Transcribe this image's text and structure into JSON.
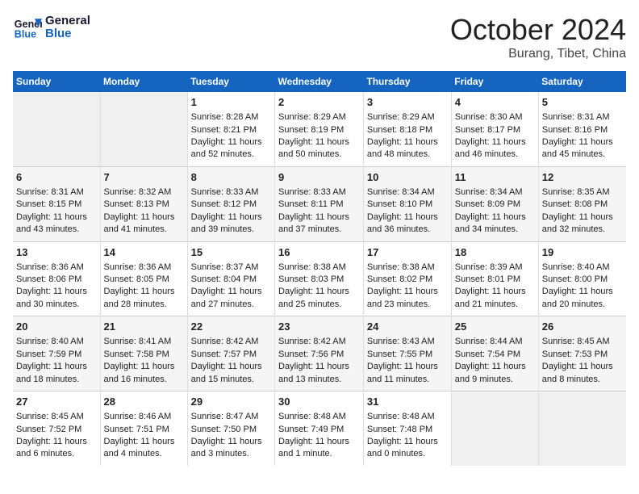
{
  "header": {
    "logo_line1": "General",
    "logo_line2": "Blue",
    "month": "October 2024",
    "location": "Burang, Tibet, China"
  },
  "weekdays": [
    "Sunday",
    "Monday",
    "Tuesday",
    "Wednesday",
    "Thursday",
    "Friday",
    "Saturday"
  ],
  "weeks": [
    [
      {
        "num": "",
        "info": "",
        "empty": true
      },
      {
        "num": "",
        "info": "",
        "empty": true
      },
      {
        "num": "1",
        "info": "Sunrise: 8:28 AM\nSunset: 8:21 PM\nDaylight: 11 hours and 52 minutes."
      },
      {
        "num": "2",
        "info": "Sunrise: 8:29 AM\nSunset: 8:19 PM\nDaylight: 11 hours and 50 minutes."
      },
      {
        "num": "3",
        "info": "Sunrise: 8:29 AM\nSunset: 8:18 PM\nDaylight: 11 hours and 48 minutes."
      },
      {
        "num": "4",
        "info": "Sunrise: 8:30 AM\nSunset: 8:17 PM\nDaylight: 11 hours and 46 minutes."
      },
      {
        "num": "5",
        "info": "Sunrise: 8:31 AM\nSunset: 8:16 PM\nDaylight: 11 hours and 45 minutes."
      }
    ],
    [
      {
        "num": "6",
        "info": "Sunrise: 8:31 AM\nSunset: 8:15 PM\nDaylight: 11 hours and 43 minutes."
      },
      {
        "num": "7",
        "info": "Sunrise: 8:32 AM\nSunset: 8:13 PM\nDaylight: 11 hours and 41 minutes."
      },
      {
        "num": "8",
        "info": "Sunrise: 8:33 AM\nSunset: 8:12 PM\nDaylight: 11 hours and 39 minutes."
      },
      {
        "num": "9",
        "info": "Sunrise: 8:33 AM\nSunset: 8:11 PM\nDaylight: 11 hours and 37 minutes."
      },
      {
        "num": "10",
        "info": "Sunrise: 8:34 AM\nSunset: 8:10 PM\nDaylight: 11 hours and 36 minutes."
      },
      {
        "num": "11",
        "info": "Sunrise: 8:34 AM\nSunset: 8:09 PM\nDaylight: 11 hours and 34 minutes."
      },
      {
        "num": "12",
        "info": "Sunrise: 8:35 AM\nSunset: 8:08 PM\nDaylight: 11 hours and 32 minutes."
      }
    ],
    [
      {
        "num": "13",
        "info": "Sunrise: 8:36 AM\nSunset: 8:06 PM\nDaylight: 11 hours and 30 minutes."
      },
      {
        "num": "14",
        "info": "Sunrise: 8:36 AM\nSunset: 8:05 PM\nDaylight: 11 hours and 28 minutes."
      },
      {
        "num": "15",
        "info": "Sunrise: 8:37 AM\nSunset: 8:04 PM\nDaylight: 11 hours and 27 minutes."
      },
      {
        "num": "16",
        "info": "Sunrise: 8:38 AM\nSunset: 8:03 PM\nDaylight: 11 hours and 25 minutes."
      },
      {
        "num": "17",
        "info": "Sunrise: 8:38 AM\nSunset: 8:02 PM\nDaylight: 11 hours and 23 minutes."
      },
      {
        "num": "18",
        "info": "Sunrise: 8:39 AM\nSunset: 8:01 PM\nDaylight: 11 hours and 21 minutes."
      },
      {
        "num": "19",
        "info": "Sunrise: 8:40 AM\nSunset: 8:00 PM\nDaylight: 11 hours and 20 minutes."
      }
    ],
    [
      {
        "num": "20",
        "info": "Sunrise: 8:40 AM\nSunset: 7:59 PM\nDaylight: 11 hours and 18 minutes."
      },
      {
        "num": "21",
        "info": "Sunrise: 8:41 AM\nSunset: 7:58 PM\nDaylight: 11 hours and 16 minutes."
      },
      {
        "num": "22",
        "info": "Sunrise: 8:42 AM\nSunset: 7:57 PM\nDaylight: 11 hours and 15 minutes."
      },
      {
        "num": "23",
        "info": "Sunrise: 8:42 AM\nSunset: 7:56 PM\nDaylight: 11 hours and 13 minutes."
      },
      {
        "num": "24",
        "info": "Sunrise: 8:43 AM\nSunset: 7:55 PM\nDaylight: 11 hours and 11 minutes."
      },
      {
        "num": "25",
        "info": "Sunrise: 8:44 AM\nSunset: 7:54 PM\nDaylight: 11 hours and 9 minutes."
      },
      {
        "num": "26",
        "info": "Sunrise: 8:45 AM\nSunset: 7:53 PM\nDaylight: 11 hours and 8 minutes."
      }
    ],
    [
      {
        "num": "27",
        "info": "Sunrise: 8:45 AM\nSunset: 7:52 PM\nDaylight: 11 hours and 6 minutes."
      },
      {
        "num": "28",
        "info": "Sunrise: 8:46 AM\nSunset: 7:51 PM\nDaylight: 11 hours and 4 minutes."
      },
      {
        "num": "29",
        "info": "Sunrise: 8:47 AM\nSunset: 7:50 PM\nDaylight: 11 hours and 3 minutes."
      },
      {
        "num": "30",
        "info": "Sunrise: 8:48 AM\nSunset: 7:49 PM\nDaylight: 11 hours and 1 minute."
      },
      {
        "num": "31",
        "info": "Sunrise: 8:48 AM\nSunset: 7:48 PM\nDaylight: 11 hours and 0 minutes."
      },
      {
        "num": "",
        "info": "",
        "empty": true
      },
      {
        "num": "",
        "info": "",
        "empty": true
      }
    ]
  ]
}
